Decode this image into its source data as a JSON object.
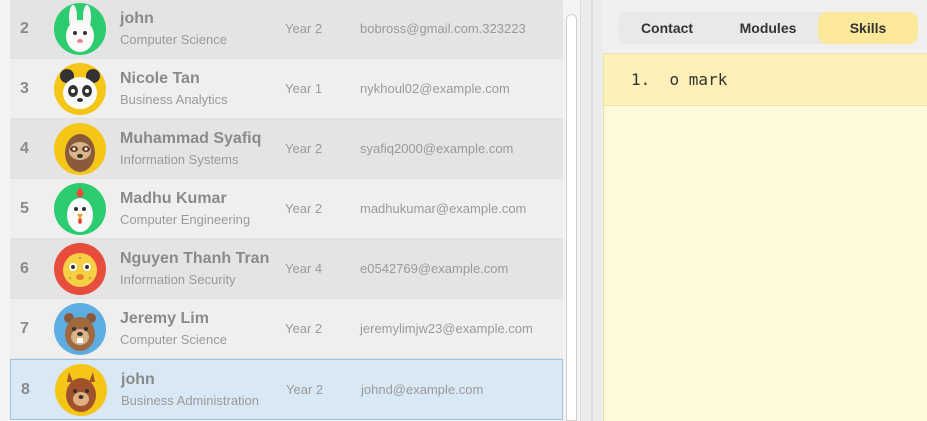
{
  "contacts": [
    {
      "index": "2",
      "name": "john",
      "major": "Computer Science",
      "year": "Year 2",
      "email": "bobross@gmail.com.323223",
      "avatar": "white-rabbit-avatar"
    },
    {
      "index": "3",
      "name": "Nicole Tan",
      "major": "Business Analytics",
      "year": "Year 1",
      "email": "nykhoul02@example.com",
      "avatar": "panda-avatar"
    },
    {
      "index": "4",
      "name": "Muhammad Syafiq",
      "major": "Information Systems",
      "year": "Year 2",
      "email": "syafiq2000@example.com",
      "avatar": "sloth-avatar"
    },
    {
      "index": "5",
      "name": "Madhu Kumar",
      "major": "Computer Engineering",
      "year": "Year 2",
      "email": "madhukumar@example.com",
      "avatar": "chicken-avatar"
    },
    {
      "index": "6",
      "name": "Nguyen Thanh Tran",
      "major": "Information Security",
      "year": "Year 4",
      "email": "e0542769@example.com",
      "avatar": "pufferfish-avatar"
    },
    {
      "index": "7",
      "name": "Jeremy Lim",
      "major": "Computer Science",
      "year": "Year 2",
      "email": "jeremylimjw23@example.com",
      "avatar": "beaver-avatar"
    },
    {
      "index": "8",
      "name": "john",
      "major": "Business Administration",
      "year": "Year 2",
      "email": "johnd@example.com",
      "avatar": "squirrel-avatar"
    }
  ],
  "tabs": {
    "contact": "Contact",
    "modules": "Modules",
    "skills": "Skills",
    "active": "Skills"
  },
  "skills": {
    "items": [
      "1.  o mark"
    ]
  },
  "colors": {
    "selected_row": "#d8e8f5",
    "active_tab": "#fbe89a",
    "skills_bg": "#fff9dc"
  }
}
